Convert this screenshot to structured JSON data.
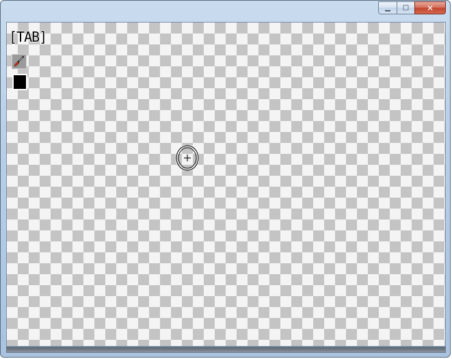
{
  "window": {
    "caption_buttons": {
      "minimize_glyph": "▁",
      "maximize_glyph": "□",
      "close_glyph": "✕"
    }
  },
  "canvas": {
    "background": "transparent-checkerboard",
    "toolbar": {
      "mode_hint": "[TAB]",
      "brush_icon": "paintbrush-icon",
      "current_color": "#000000"
    },
    "cursor_icon": "crosshair-circle-icon"
  },
  "colors": {
    "checker_dark": "#c4c4c4",
    "checker_light": "#f4f4f4",
    "close_button": "#c2452c",
    "frame": "#b8cfe6"
  }
}
